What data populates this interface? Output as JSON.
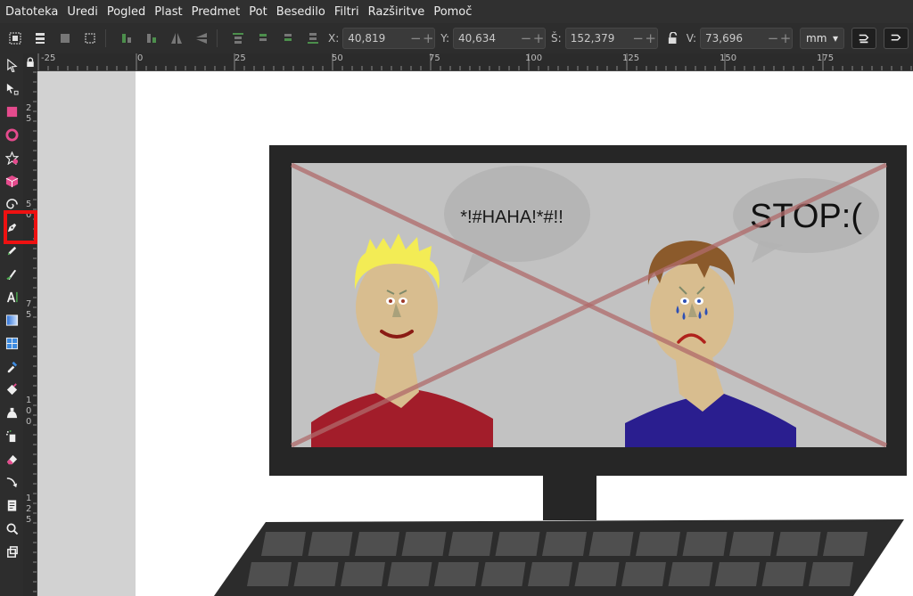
{
  "menu": [
    "Datoteka",
    "Uredi",
    "Pogled",
    "Plast",
    "Predmet",
    "Pot",
    "Besedilo",
    "Filtri",
    "Razširitve",
    "Pomoč"
  ],
  "toolbar": {
    "x_label": "X:",
    "x_value": "40,819",
    "y_label": "Y:",
    "y_value": "40,634",
    "w_label": "Š:",
    "w_value": "152,379",
    "h_label": "V:",
    "h_value": "73,696",
    "unit": "mm"
  },
  "ruler_top": [
    "-25",
    "0",
    "25",
    "50",
    "75",
    "100",
    "125",
    "150",
    "175"
  ],
  "ruler_left": [
    "2",
    "5",
    "5",
    "0",
    "7",
    "5",
    "1",
    "0",
    "0",
    "1",
    "2",
    "5"
  ],
  "tools": [
    "selector-arrow-icon",
    "node-editor-icon",
    "rectangle-tool-icon",
    "ellipse-tool-icon",
    "star-tool-icon",
    "3d-box-tool-icon",
    "spiral-tool-icon",
    "pen-bezier-tool-icon",
    "pencil-tool-icon",
    "calligraphy-tool-icon",
    "text-tool-icon",
    "gradient-tool-icon",
    "mesh-tool-icon",
    "dropper-tool-icon",
    "paint-bucket-icon",
    "tweak-tool-icon",
    "spray-tool-icon",
    "eraser-tool-icon",
    "connector-tool-icon",
    "pages-tool-icon",
    "zoom-tool-icon",
    "measure-tool-icon"
  ],
  "artwork": {
    "bubble_left_text": "*!#HAHA!*#!!",
    "bubble_right_text": "STOP:(",
    "colors": {
      "monitor": "#262626",
      "screen": "#c2c2c2",
      "cross": "#b06a6a",
      "skin": "#d8bd8f",
      "hair_left": "#f3ec55",
      "hair_right": "#8b5a2b",
      "shirt_left": "#a21d2a",
      "shirt_right": "#2a1e8f",
      "tears": "#2d4fb4",
      "keyboard": "#2c2c2c",
      "keys": "#535353",
      "highlight": "#ee1111"
    }
  }
}
